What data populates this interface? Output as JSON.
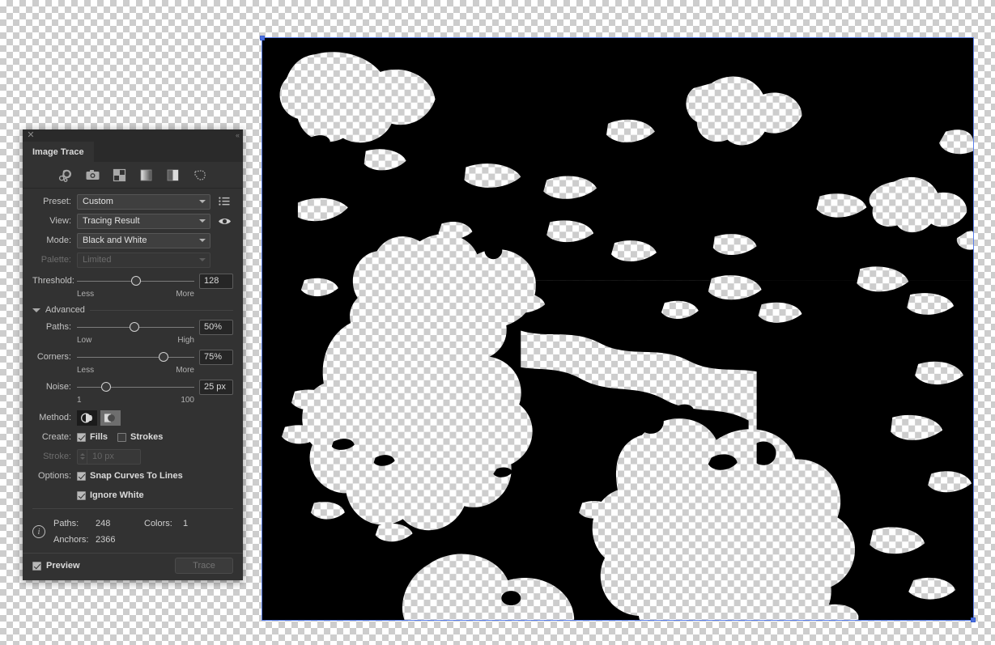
{
  "panel": {
    "tab_label": "Image Trace",
    "close_icon": "close-icon",
    "collapse_icon": "collapse-double-arrow-icon",
    "preset_icons": [
      "auto-color-icon",
      "high-fidelity-photo-icon",
      "low-fidelity-photo-icon",
      "grayscale-icon",
      "black-and-white-icon",
      "outline-icon"
    ],
    "preset": {
      "label": "Preset:",
      "value": "Custom",
      "menu_icon": "preset-menu-icon"
    },
    "view": {
      "label": "View:",
      "value": "Tracing Result",
      "eye_icon": "eye-icon"
    },
    "mode": {
      "label": "Mode:",
      "value": "Black and White"
    },
    "palette": {
      "label": "Palette:",
      "value": "Limited",
      "disabled": true
    },
    "threshold": {
      "label": "Threshold:",
      "value": "128",
      "percent": 50,
      "min_label": "Less",
      "max_label": "More"
    },
    "advanced": {
      "label": "Advanced",
      "expanded": true
    },
    "paths": {
      "label": "Paths:",
      "value": "50%",
      "percent": 49,
      "min_label": "Low",
      "max_label": "High"
    },
    "corners": {
      "label": "Corners:",
      "value": "75%",
      "percent": 74,
      "min_label": "Less",
      "max_label": "More"
    },
    "noise": {
      "label": "Noise:",
      "value": "25 px",
      "percent": 25,
      "min_label": "1",
      "max_label": "100"
    },
    "method": {
      "label": "Method:",
      "abutting_icon": "method-abutting-icon",
      "overlapping_icon": "method-overlapping-icon",
      "selected": "abutting"
    },
    "create": {
      "label": "Create:",
      "fills_label": "Fills",
      "fills_checked": true,
      "strokes_label": "Strokes",
      "strokes_checked": false
    },
    "stroke": {
      "label": "Stroke:",
      "value": "10 px",
      "disabled": true
    },
    "options": {
      "label": "Options:",
      "snap_curves_label": "Snap Curves To Lines",
      "snap_curves_checked": true,
      "ignore_white_label": "Ignore White",
      "ignore_white_checked": true
    },
    "info": {
      "icon": "info-icon",
      "paths_key": "Paths:",
      "paths_value": "248",
      "colors_key": "Colors:",
      "colors_value": "1",
      "anchors_key": "Anchors:",
      "anchors_value": "2366"
    },
    "footer": {
      "preview_label": "Preview",
      "preview_checked": true,
      "trace_label": "Trace",
      "trace_disabled": true
    }
  },
  "canvas": {
    "name": "tracing-result-artwork",
    "selection_color": "#5a7fea",
    "fill_color": "#000000",
    "background": "transparent-checkerboard"
  }
}
